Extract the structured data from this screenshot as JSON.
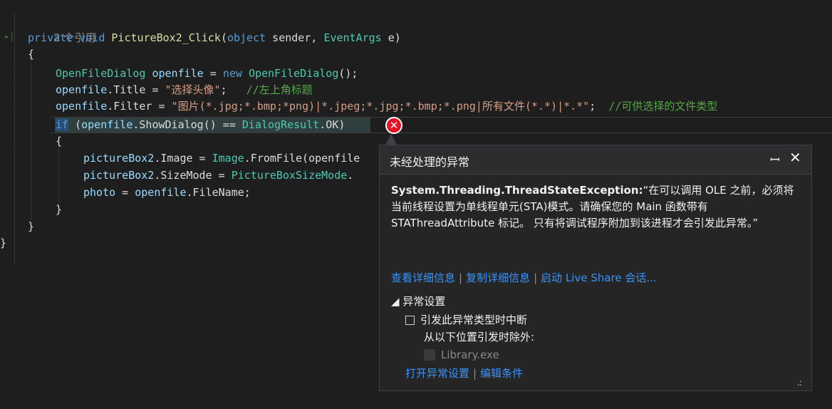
{
  "code": {
    "reference_count": "2 个引用",
    "line_sig": {
      "kw1": "private",
      "kw2": "void",
      "method": "PictureBox2_Click",
      "p_open": "(",
      "kw_object": "object",
      "p_sender": " sender, ",
      "type_eventargs": "EventArgs",
      "p_e": " e)"
    },
    "brace_open": "{",
    "line_decl": {
      "type": "OpenFileDialog",
      "var": "openfile",
      "eq": " = ",
      "kw_new": "new",
      "ctor": "OpenFileDialog",
      "end": "();"
    },
    "line_title": {
      "obj": "openfile",
      "prop": ".Title = ",
      "str": "\"选择头像\"",
      "semi": ";",
      "comment": "//左上角标题"
    },
    "line_filter": {
      "obj": "openfile",
      "prop": ".Filter = ",
      "str": "\"图片(*.jpg;*.bmp;*png)|*.jpeg;*.jpg;*.bmp;*.png|所有文件(*.*)|*.*\"",
      "semi": ";",
      "comment": "//可供选择的文件类型"
    },
    "line_if": {
      "kw_if": "if",
      "p_open": " (",
      "obj": "openfile",
      "call": ".ShowDialog() == ",
      "type": "DialogResult",
      "rest": ".OK)"
    },
    "inner_brace_open": "{",
    "line_image": {
      "obj": "pictureBox2",
      "prop": ".Image = ",
      "type": "Image",
      "call": ".FromFile(openfile"
    },
    "line_sizemode": {
      "obj": "pictureBox2",
      "prop": ".SizeMode = ",
      "type": "PictureBoxSizeMode",
      "rest": "."
    },
    "line_photo": {
      "var": "photo",
      "eq": " = ",
      "obj": "openfile",
      "rest": ".FileName;"
    },
    "inner_brace_close": "}",
    "brace_close": "}",
    "outer_brace_close": "}"
  },
  "error_icon": "error-x-icon",
  "popup": {
    "title": "未经处理的异常",
    "pin_glyph": "📌",
    "close_glyph": "✕",
    "exception_type": "System.Threading.ThreadStateException:",
    "exception_message": "“在可以调用 OLE 之前，必须将当前线程设置为单线程单元(STA)模式。请确保您的 Main 函数带有 STAThreadAttribute 标记。 只有将调试程序附加到该进程才会引发此异常。”",
    "links": {
      "view_details": "查看详细信息",
      "copy_details": "复制详细信息",
      "live_share": "启动 Live Share 会话..."
    },
    "exception_settings": {
      "section_label": "异常设置",
      "break_label": "引发此异常类型时中断",
      "break_checked": false,
      "except_label": "从以下位置引发时除外:",
      "library_label": "Library.exe",
      "library_checked": false,
      "open_settings": "打开异常设置",
      "edit_conditions": "编辑条件"
    }
  },
  "colors": {
    "background": "#1e1e1e",
    "keyword": "#569cd6",
    "type": "#4ec9b0",
    "string": "#d69d85",
    "comment": "#57a64a",
    "link": "#3794ff",
    "error_red": "#e81123"
  }
}
